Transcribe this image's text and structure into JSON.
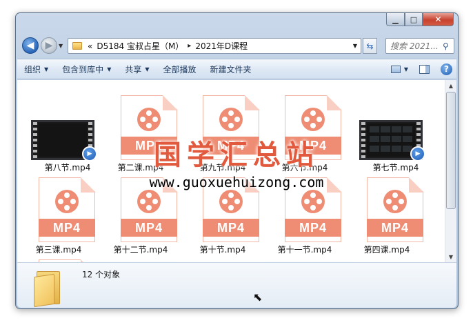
{
  "window": {
    "caption": {
      "minimize": "▁",
      "maximize": "□",
      "close": "✕"
    }
  },
  "nav": {
    "back": "◀",
    "forward": "▶",
    "address_prefix": "«",
    "crumbs": [
      "D5184 宝叔占星（M）",
      "2021年D课程"
    ],
    "crumb_separator": "▸",
    "search_placeholder": "搜索 2021..."
  },
  "toolbar": {
    "organize": "组织",
    "include_library": "包含到库中",
    "share": "共享",
    "play_all": "全部播放",
    "new_folder": "新建文件夹",
    "help": "?"
  },
  "files": [
    {
      "name": "第八节.mp4",
      "kind": "video-dark"
    },
    {
      "name": "第二课.mp4",
      "kind": "mp4"
    },
    {
      "name": "第九节.mp4",
      "kind": "mp4"
    },
    {
      "name": "第六节.mp4",
      "kind": "mp4"
    },
    {
      "name": "第七节.mp4",
      "kind": "video-grid"
    },
    {
      "name": "第三课.mp4",
      "kind": "mp4"
    },
    {
      "name": "第十二节.mp4",
      "kind": "mp4"
    },
    {
      "name": "第十节.mp4",
      "kind": "mp4"
    },
    {
      "name": "第十一节.mp4",
      "kind": "mp4"
    },
    {
      "name": "第四课.mp4",
      "kind": "mp4"
    }
  ],
  "mp4_badge": "MP4",
  "details": {
    "count": "12 个对象"
  },
  "watermark": {
    "title": "国学汇总站",
    "url": "www.guoxuehuizong.com"
  },
  "colors": {
    "mp4_accent": "#ee8d74",
    "watermark_red": "#e25a3e"
  }
}
